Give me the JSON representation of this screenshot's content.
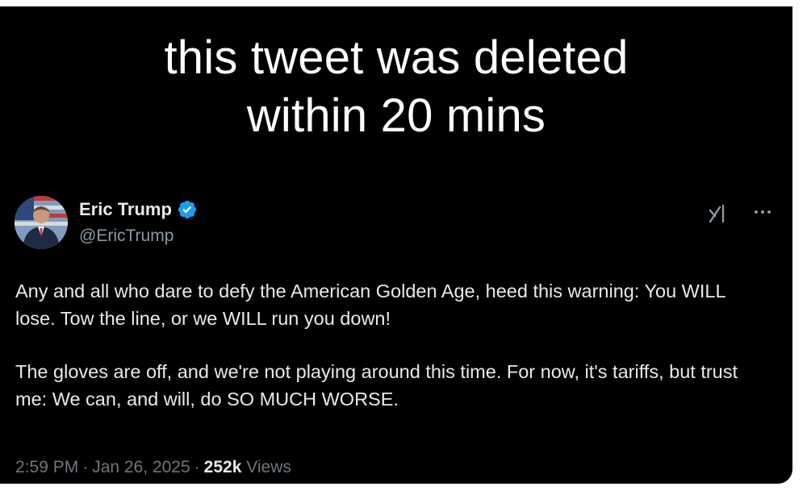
{
  "caption": {
    "line1": "this tweet was deleted",
    "line2": "within 20 mins"
  },
  "tweet": {
    "author": {
      "display_name": "Eric Trump",
      "handle": "@EricTrump",
      "verified": true
    },
    "paragraphs": [
      "Any and all who dare to defy the American Golden Age, heed this warning: You WILL lose. Tow the line, or we WILL run you down!",
      "The gloves are off, and we're not playing around this time. For now, it's tariffs, but trust me: We can, and will, do SO MUCH WORSE."
    ],
    "time": "2:59 PM",
    "date": "Jan 26, 2025",
    "views_count": "252k",
    "views_label": "Views",
    "separator": "·"
  },
  "icons": {
    "verified": "verified-badge-icon",
    "grok": "grok-icon",
    "more": "more-options-icon"
  },
  "colors": {
    "background": "#000000",
    "text": "#e7e9ea",
    "secondary": "#8b98a5",
    "verified_blue": "#1d9bf0"
  }
}
